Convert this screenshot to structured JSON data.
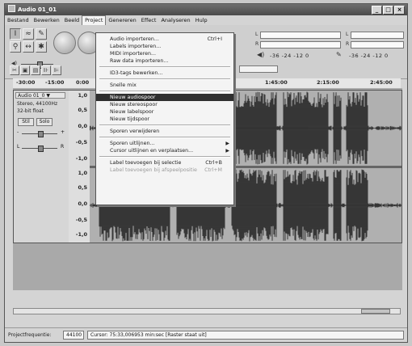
{
  "window": {
    "title": "Audio 01_01",
    "min": "_",
    "max": "□",
    "close": "×"
  },
  "menubar": [
    "Bestand",
    "Bewerken",
    "Beeld",
    "Project",
    "Genereren",
    "Effect",
    "Analyseren",
    "Hulp"
  ],
  "project_menu": [
    {
      "label": "Audio importeren...",
      "shortcut": "Ctrl+I"
    },
    {
      "label": "Labels importeren..."
    },
    {
      "label": "MIDI importeren..."
    },
    {
      "label": "Raw data importeren..."
    },
    {
      "sep": true
    },
    {
      "label": "ID3-tags bewerken..."
    },
    {
      "sep": true
    },
    {
      "label": "Snelle mix"
    },
    {
      "sep": true
    },
    {
      "label": "Nieuw audiospoor",
      "highlighted": true
    },
    {
      "label": "Nieuw stereospoor"
    },
    {
      "label": "Nieuw labelspoor"
    },
    {
      "label": "Nieuw tijdspoor"
    },
    {
      "sep": true
    },
    {
      "label": "Sporen verwijderen"
    },
    {
      "sep": true
    },
    {
      "label": "Sporen uitlijnen...",
      "submenu": true
    },
    {
      "label": "Cursor uitlijnen en verplaatsen...",
      "submenu": true
    },
    {
      "sep": true
    },
    {
      "label": "Label toevoegen bij selectie",
      "shortcut": "Ctrl+B"
    },
    {
      "label": "Label toevoegen bij afspeelpositie",
      "shortcut": "Ctrl+M",
      "disabled": true
    }
  ],
  "toolbar": {
    "meter_l": "L",
    "meter_r": "R",
    "meter_scale_1": "-36  -24  -12  0",
    "meter_scale_2": "-36  -24  -12  0"
  },
  "timeline": [
    "-30:00",
    "-15:00",
    "0:00",
    "1:45:00",
    "2:15:00",
    "2:45:00"
  ],
  "track": {
    "name": "Audio 01_0",
    "info1": "Stereo, 44100Hz",
    "info2": "32-bit float",
    "stil": "Stil",
    "solo": "Solo",
    "minus": "-",
    "plus": "+",
    "left": "L",
    "right": "R"
  },
  "channel_scale": [
    "1,0",
    "0,5",
    "0,0",
    "-0,5",
    "-1,0"
  ],
  "status": {
    "projectrate_label": "Projectfrequentie:",
    "projectrate": "44100",
    "cursor": "Cursor: 75:33,006953 min:sec   [Raster staat uit]"
  }
}
